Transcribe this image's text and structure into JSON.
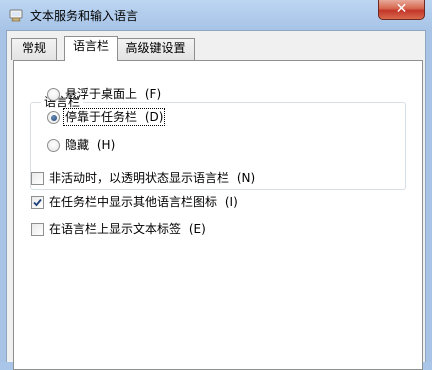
{
  "window": {
    "title": "文本服务和输入语言",
    "close_label": "✕"
  },
  "tabs": [
    {
      "label": "常规",
      "active": false
    },
    {
      "label": "语言栏",
      "active": true
    },
    {
      "label": "高级键设置",
      "active": false
    }
  ],
  "language_bar": {
    "group_title": "语言栏",
    "options": [
      {
        "label": "悬浮于桌面上",
        "mnemonic": "F",
        "selected": false
      },
      {
        "label": "停靠于任务栏",
        "mnemonic": "D",
        "selected": true
      },
      {
        "label": "隐藏",
        "mnemonic": "H",
        "selected": false
      }
    ]
  },
  "checkboxes": [
    {
      "label": "非活动时，以透明状态显示语言栏",
      "mnemonic": "N",
      "checked": false
    },
    {
      "label": "在任务栏中显示其他语言栏图标",
      "mnemonic": "I",
      "checked": true
    },
    {
      "label": "在语言栏上显示文本标签",
      "mnemonic": "E",
      "checked": false
    }
  ]
}
